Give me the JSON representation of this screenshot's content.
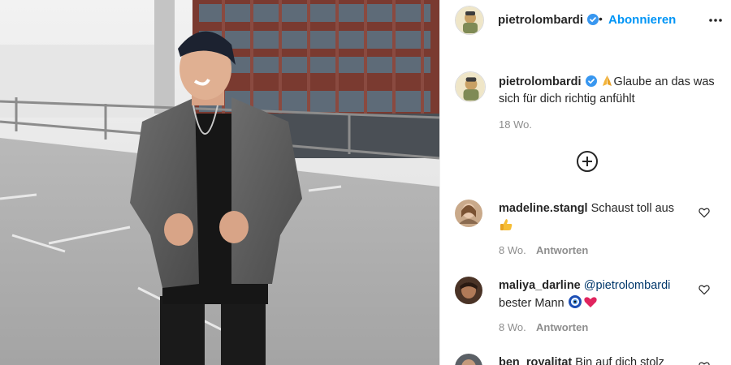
{
  "post": {
    "author": "pietrolombardi",
    "follow_label": "Abonnieren",
    "separator": "•",
    "caption_text": "Glaube an das was sich für dich richtig anfühlt",
    "caption_time": "18 Wo.",
    "icons": {
      "verified": "verified-badge-icon",
      "more": "more-options-icon",
      "load_more": "plus-circle-icon",
      "like": "heart-icon",
      "caption_emoji": "folded-hands-emoji"
    },
    "colors": {
      "accent": "#0095f6",
      "verified": "#3897f0",
      "muted": "#8e8e8e",
      "mention": "#00376b"
    }
  },
  "comments": [
    {
      "user": "madeline.stangl",
      "text": "Schaust toll aus",
      "emoji": "thumbs-up-emoji",
      "time": "8 Wo.",
      "reply": "Antworten"
    },
    {
      "user": "maliya_darline",
      "mention": "@pietrolombardi",
      "text": "bester Mann",
      "emoji": "nazar-and-heart-emoji",
      "time": "8 Wo.",
      "reply": "Antworten"
    },
    {
      "user": "ben_royalitat",
      "text": "Bin auf dich stolz"
    }
  ]
}
